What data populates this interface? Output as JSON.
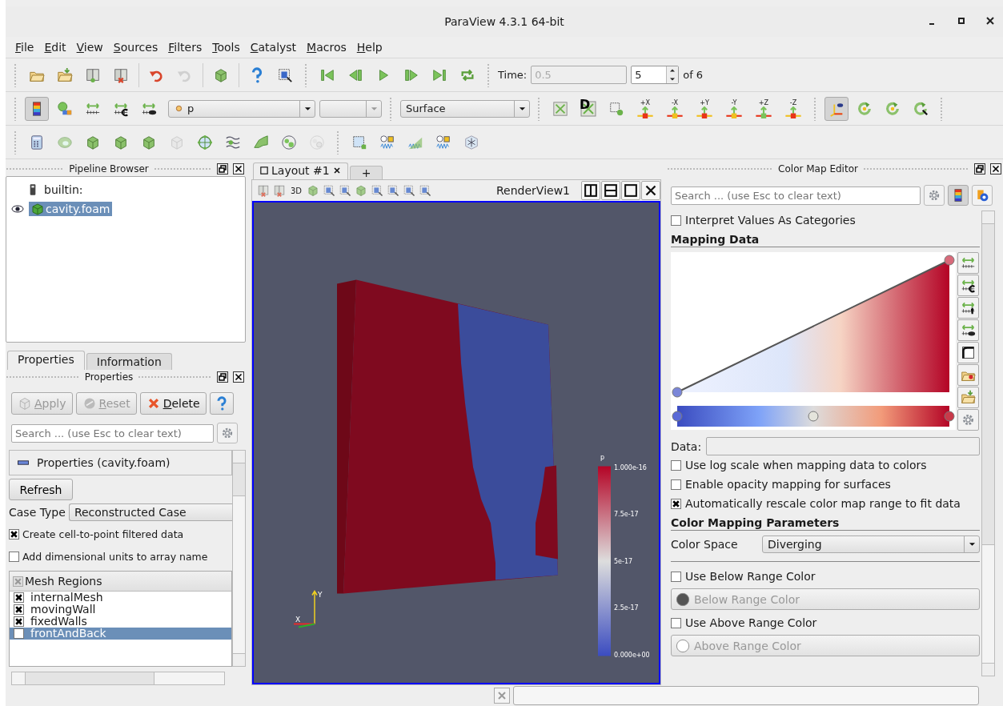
{
  "window": {
    "title": "ParaView 4.3.1 64-bit"
  },
  "menu": [
    "File",
    "Edit",
    "View",
    "Sources",
    "Filters",
    "Tools",
    "Catalyst",
    "Macros",
    "Help"
  ],
  "time": {
    "label": "Time:",
    "value": "0.5",
    "disabled": true,
    "step": "5",
    "of": "of 6"
  },
  "toolbar": {
    "color_legend_on": true,
    "array": "p",
    "representation": "Surface",
    "reset_closest_mark": "D",
    "view_directions": [
      "+X",
      "-X",
      "+Y",
      "-Y",
      "+Z",
      "-Z"
    ],
    "center_axes_on": true
  },
  "pipeline_browser": {
    "title": "Pipeline Browser",
    "items": [
      {
        "label": "builtin:",
        "selected": false,
        "children": [
          {
            "label": "cavity.foam",
            "selected": true,
            "visible": true
          }
        ]
      }
    ]
  },
  "panel_tabs": [
    {
      "label": "Properties",
      "selected": true
    },
    {
      "label": "Information",
      "selected": false
    }
  ],
  "properties": {
    "title": "Properties",
    "buttons": [
      {
        "label": "Apply",
        "disabled": true
      },
      {
        "label": "Reset",
        "disabled": true
      },
      {
        "label": "Delete",
        "disabled": false
      }
    ],
    "search": {
      "placeholder": "Search ... (use Esc to clear text)"
    },
    "section": "Properties (cavity.foam)",
    "refresh": "Refresh",
    "case_type": {
      "label": "Case Type",
      "value": "Reconstructed Case"
    },
    "options": [
      {
        "label": "Create cell-to-point filtered data",
        "checked": true
      },
      {
        "label": "Add dimensional units to array name",
        "checked": false
      }
    ],
    "mesh_regions": {
      "title": "Mesh Regions",
      "header_partially_checked": true,
      "rows": [
        {
          "label": "internalMesh",
          "checked": true,
          "selected": false
        },
        {
          "label": "movingWall",
          "checked": true,
          "selected": false
        },
        {
          "label": "fixedWalls",
          "checked": true,
          "selected": false
        },
        {
          "label": "frontAndBack",
          "checked": false,
          "selected": true
        }
      ]
    }
  },
  "layout_tabs": [
    {
      "label": "Layout #1",
      "selected": true
    }
  ],
  "new_tab": "+",
  "view": {
    "mode_3d": "3D",
    "title": "RenderView1",
    "active": true,
    "color_legend": {
      "title": "p",
      "ticks": [
        "1.000e-16",
        "7.5e-17",
        "5e-17",
        "2.5e-17",
        "0.000e+00"
      ]
    },
    "axes": {
      "x": "X",
      "y": "Y"
    }
  },
  "color_map_editor": {
    "title": "Color Map Editor",
    "search": {
      "placeholder": "Search ... (use Esc to clear text)"
    },
    "categories": {
      "label": "Interpret Values As Categories",
      "checked": false
    },
    "mapping_title": "Mapping Data",
    "data": {
      "label": "Data:"
    },
    "options": [
      {
        "label": "Use log scale when mapping data to colors",
        "checked": false
      },
      {
        "label": "Enable opacity mapping for surfaces",
        "checked": false
      },
      {
        "label": "Automatically rescale color map range to fit data",
        "checked": true
      }
    ],
    "parameters_title": "Color Mapping Parameters",
    "color_space": {
      "label": "Color Space",
      "value": "Diverging"
    },
    "below": {
      "label": "Use Below Range Color",
      "checked": false,
      "button": "Below Range Color",
      "disabled": true
    },
    "above": {
      "label": "Use Above Range Color",
      "checked": false,
      "button": "Above Range Color",
      "disabled": true
    }
  }
}
